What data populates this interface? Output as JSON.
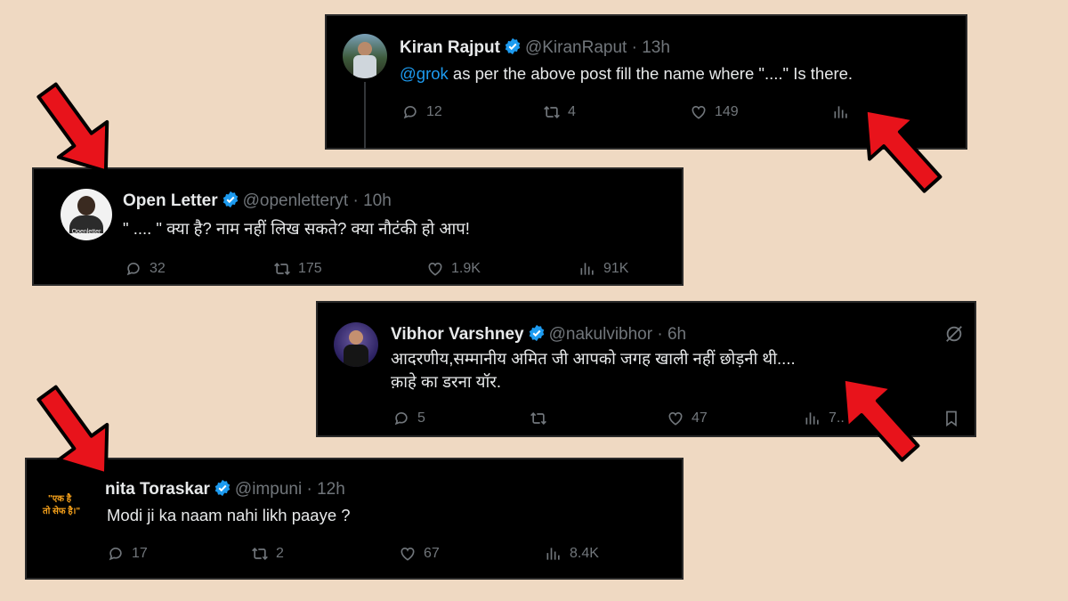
{
  "tweets": [
    {
      "name": "Kiran Rajput",
      "handle": "@KiranRaput",
      "sep": "·",
      "time": "13h",
      "mention": "@grok",
      "text": " as per the above post fill the name where  \"....\" Is there.",
      "replies": "12",
      "retweets": "4",
      "likes": "149",
      "views": ""
    },
    {
      "name": "Open Letter",
      "handle": "@openletteryt",
      "sep": "·",
      "time": "10h",
      "text": "\" .... \" क्या है? नाम नहीं लिख सकते? क्या नौटंकी हो आप!",
      "avatar_label": "Openletter",
      "replies": "32",
      "retweets": "175",
      "likes": "1.9K",
      "views": "91K"
    },
    {
      "name": "Vibhor Varshney",
      "handle": "@nakulvibhor",
      "sep": "·",
      "time": "6h",
      "text_line1": "आदरणीय,सम्मानीय अमित जी आपको जगह खाली नहीं छोड़नी थी....",
      "text_line2": "क़ाहे का डरना यॉर.",
      "replies": "5",
      "retweets": "",
      "likes": "47",
      "views": "7.."
    },
    {
      "name": "Punita Toraskar",
      "name_visible": "nita Toraskar",
      "handle": "@impuni",
      "sep": "·",
      "time": "12h",
      "text": "Modi ji ka naam nahi likh paaye ?",
      "avatar_line1": "\"एक है",
      "avatar_line2": "तो सेफ है।\"",
      "replies": "17",
      "retweets": "2",
      "likes": "67",
      "views": "8.4K"
    }
  ],
  "colors": {
    "background": "#efd9c2",
    "card": "#000000",
    "text": "#e7e9ea",
    "muted": "#71767b",
    "mention": "#1d9bf0",
    "verified": "#1d9bf0",
    "arrow": "#e8131b"
  },
  "icons": [
    "reply-icon",
    "retweet-icon",
    "like-icon",
    "views-icon",
    "verified-badge-icon",
    "bookmark-icon",
    "grok-icon",
    "red-arrow-icon"
  ]
}
